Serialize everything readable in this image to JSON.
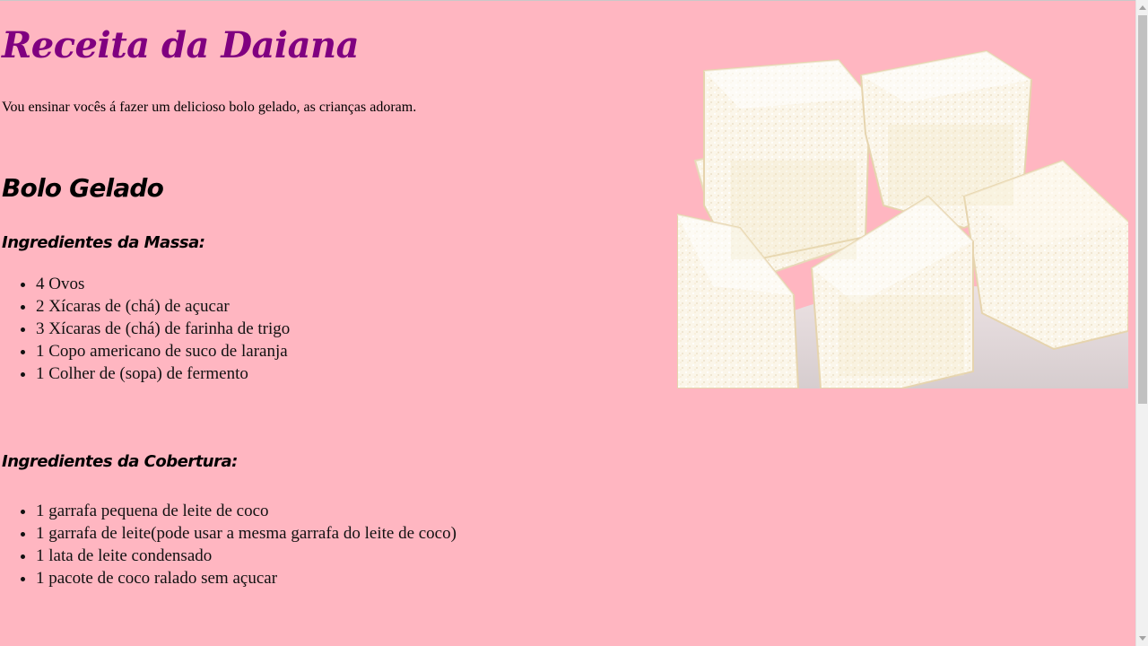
{
  "page": {
    "title": "Receita da Daiana",
    "intro": "Vou ensinar vocês á fazer um delicioso bolo gelado, as crianças adoram.",
    "recipe_title": "Bolo Gelado",
    "massa": {
      "heading": "Ingredientes da Massa:",
      "items": [
        "4 Ovos",
        "2 Xícaras de (chá) de açucar",
        "3 Xícaras de (chá) de farinha de trigo",
        "1 Copo americano de suco de laranja",
        "1 Colher de (sopa) de fermento"
      ]
    },
    "cobertura": {
      "heading": "Ingredientes da Cobertura:",
      "items": [
        "1 garrafa pequena de leite de coco",
        "1 garrafa de leite(pode usar a mesma garrafa do leite de coco)",
        "1 lata de leite condensado",
        "1 pacote de coco ralado sem açucar"
      ]
    }
  },
  "colors": {
    "background": "#ffb6c1",
    "title": "#800080"
  },
  "image": {
    "subject": "bolo-gelado-photo"
  }
}
